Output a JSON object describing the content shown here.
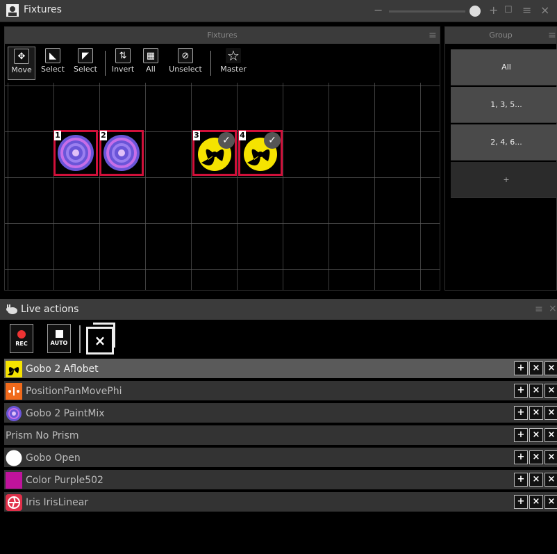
{
  "window": {
    "title": "Fixtures",
    "controls": [
      "−",
      "+",
      "☐",
      "≡",
      "×"
    ]
  },
  "fixtures_panel": {
    "header": "Fixtures",
    "menu": "≡",
    "tools": [
      {
        "label": "Move",
        "glyph": "✥"
      },
      {
        "label": "Select",
        "glyph": "◣"
      },
      {
        "label": "Select",
        "glyph": "◤"
      },
      {
        "label": "Invert",
        "glyph": "⇅"
      },
      {
        "label": "All",
        "glyph": "▦"
      },
      {
        "label": "Unselect",
        "glyph": "⊘"
      },
      {
        "label": "Master",
        "glyph": "☆"
      }
    ],
    "fixtures": [
      {
        "number": "1",
        "type": "gobo-paintmix",
        "selected": true,
        "checked": false
      },
      {
        "number": "2",
        "type": "gobo-paintmix",
        "selected": true,
        "checked": false
      },
      {
        "number": "3",
        "type": "gobo-aflobet",
        "selected": true,
        "checked": true
      },
      {
        "number": "4",
        "type": "gobo-aflobet",
        "selected": true,
        "checked": true
      }
    ]
  },
  "group_panel": {
    "header": "Group",
    "menu": "≡",
    "groups": [
      "All",
      "1, 3, 5...",
      "2, 4, 6...",
      "+"
    ]
  },
  "live_actions": {
    "title": "Live actions",
    "menu": "≡",
    "close": "×",
    "rec_label": "REC",
    "auto_label": "AUTO",
    "clear_glyph": "×",
    "rows": [
      {
        "label": "Gobo 2 Aflobet",
        "icon": "gobo-aflobet-icon",
        "selected": true
      },
      {
        "label": "PositionPanMovePhi",
        "icon": "position-icon",
        "selected": false
      },
      {
        "label": "Gobo 2 PaintMix",
        "icon": "gobo-paintmix-icon",
        "selected": false
      },
      {
        "label": "Prism No Prism",
        "icon": "",
        "selected": false
      },
      {
        "label": "Gobo Open",
        "icon": "gobo-open-icon",
        "selected": false
      },
      {
        "label": "Color Purple502",
        "icon": "color-swatch-icon",
        "selected": false
      },
      {
        "label": "Iris IrisLinear",
        "icon": "iris-icon",
        "selected": false
      }
    ],
    "row_buttons": [
      "+",
      "×",
      "×"
    ]
  },
  "colors": {
    "selection_border": "#d0103a",
    "purple": "#c0139c",
    "gobo_yellow": "#f5e300",
    "position_orange": "#f06a1c"
  }
}
